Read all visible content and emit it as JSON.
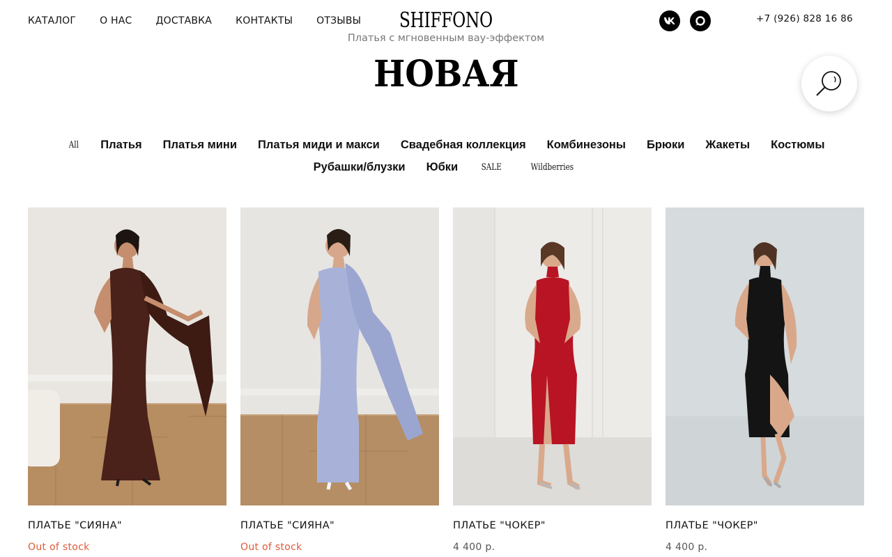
{
  "header": {
    "nav": [
      "КАТАЛОГ",
      "О НАС",
      "ДОСТАВКА",
      "КОНТАКТЫ",
      "ОТЗЫВЫ"
    ],
    "logo": "SHIFFONO",
    "tagline": "Платья с мгновенным вау-эффектом",
    "social": [
      {
        "icon": "vk-icon",
        "label": "VK"
      },
      {
        "icon": "chat-icon",
        "label": ""
      }
    ],
    "phone": "+7 (926) 828 16 86"
  },
  "page": {
    "title": "НОВАЯ"
  },
  "categories": {
    "row1": [
      "All",
      "Платья",
      "Платья мини",
      "Платья миди и макси",
      "Свадебная коллекция",
      "Комбинезоны",
      "Брюки",
      "Жакеты",
      "Костюмы"
    ],
    "row2": [
      "Рубашки/блузки",
      "Юбки",
      "SALE",
      "Wildberries"
    ]
  },
  "products": [
    {
      "title": "ПЛАТЬЕ \"СИЯНА\"",
      "price": "Out of stock",
      "dress_color": "#4a2219",
      "bg": "#e9e6e1",
      "floor": "#b78d62"
    },
    {
      "title": "ПЛАТЬЕ \"СИЯНА\"",
      "price": "Out of stock",
      "dress_color": "#a8b2d8",
      "bg": "#e7e5e2",
      "floor": "#b58e66"
    },
    {
      "title": "ПЛАТЬЕ \"ЧОКЕР\"",
      "price": "4 400 р.",
      "dress_color": "#b81423",
      "bg": "#ecebe8",
      "floor": "#dddcd8"
    },
    {
      "title": "ПЛАТЬЕ \"ЧОКЕР\"",
      "price": "4 400 р.",
      "dress_color": "#141414",
      "bg": "#d6dbde",
      "floor": "#cfd4d7"
    }
  ],
  "colors": {
    "out_of_stock": "#e05a3a",
    "price": "#555555",
    "text": "#111111"
  }
}
